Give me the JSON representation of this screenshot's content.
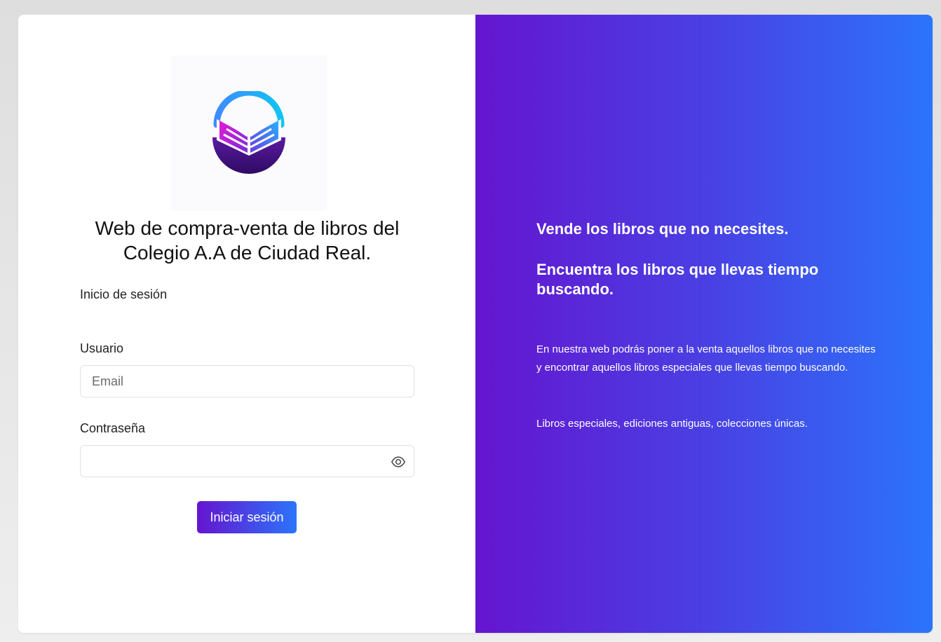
{
  "login": {
    "title": "Web de compra-venta de libros del Colegio A.A de Ciudad Real.",
    "subtitle": "Inicio de sesión",
    "user_label": "Usuario",
    "email_placeholder": "Email",
    "password_label": "Contraseña",
    "password_value": "",
    "submit_label": "Iniciar sesión"
  },
  "promo": {
    "heading_1": "Vende los libros que no necesites.",
    "heading_2": "Encuentra los libros que llevas tiempo buscando.",
    "paragraph_1": "En nuestra web podrás poner a la venta aquellos libros que no necesites y encontrar aquellos libros especiales que llevas tiempo buscando.",
    "paragraph_2": "Libros especiales, ediciones antiguas, colecciones únicas."
  },
  "colors": {
    "accent_purple": "#6515cf",
    "accent_blue": "#2b74fb"
  },
  "icons": {
    "logo": "open-book-logo",
    "password_toggle": "eye-icon"
  }
}
